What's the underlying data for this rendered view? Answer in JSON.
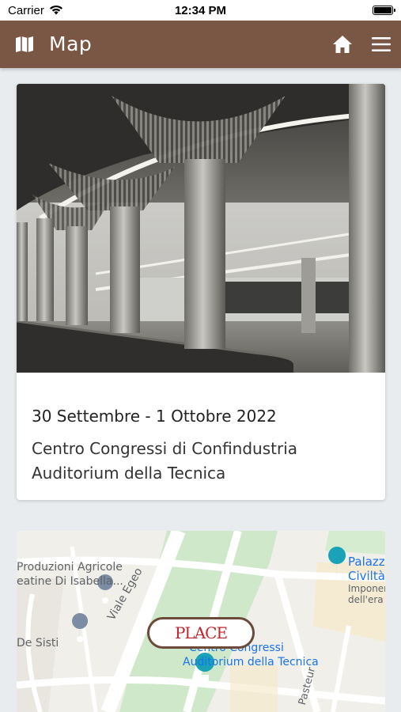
{
  "status_bar": {
    "carrier": "Carrier",
    "time": "12:34 PM"
  },
  "navbar": {
    "title": "Map",
    "icons": [
      "map-icon",
      "home-icon",
      "menu-icon"
    ],
    "background": "#7a5645"
  },
  "event": {
    "date": "30 Settembre - 1 Ottobre 2022",
    "venue_line1": "Centro Congressi di Confindustria",
    "venue_line2": "Auditorium della Tecnica"
  },
  "map": {
    "labels": {
      "produzioni_1": "Produzioni Agricole",
      "produzioni_2": "eatine Di Isabella...",
      "de_sisti": "De Sisti",
      "viale_egeo": "Viale Egeo",
      "centro_1": "Centro Congressi",
      "centro_2": "Auditorium della Tecnica",
      "palazzo_1": "Palazz",
      "palazzo_2": "Civiltà",
      "palazzo_3": "Imponer",
      "palazzo_4": "dell'era",
      "pasteur": "Pasteur"
    },
    "logo_text": "PLACE"
  }
}
